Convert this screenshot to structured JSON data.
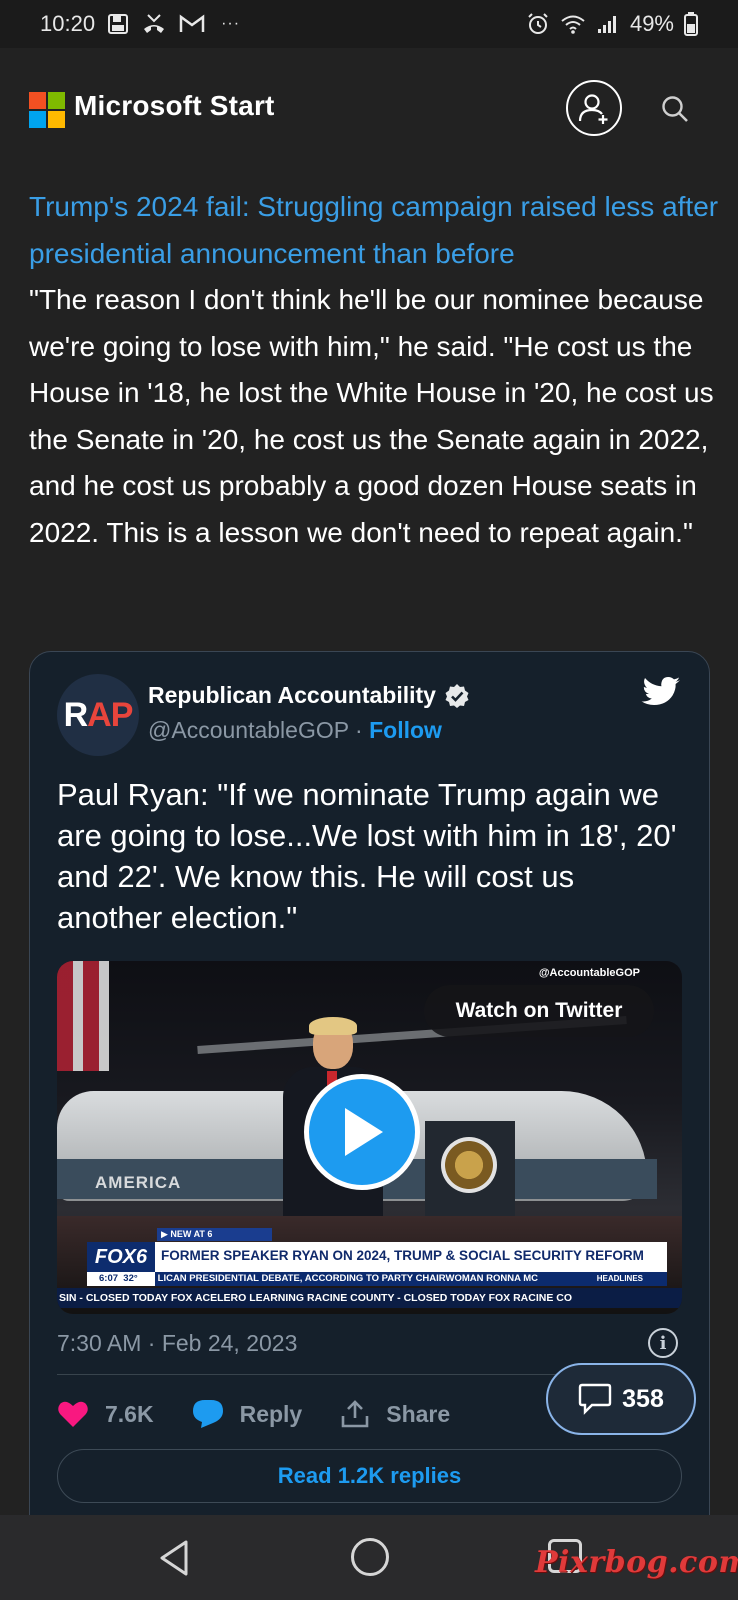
{
  "status_bar": {
    "time": "10:20",
    "battery": "49%",
    "overflow": "···"
  },
  "app": {
    "brand": "Microsoft Start",
    "logo_colors": [
      "#f25022",
      "#7fba00",
      "#00a4ef",
      "#ffb900"
    ]
  },
  "article": {
    "headline": "Trump's 2024 fail: Struggling campaign raised less after presidential announcement than before",
    "quote": "\"The reason I don't think he'll be our nominee because we're going to lose with him,\" he said. \"He cost us the House in '18, he lost the White House in '20, he cost us the Senate in '20, he cost us the Senate again in 2022, and he cost us probably a good dozen House seats in 2022. This is a lesson we don't need to repeat again.\""
  },
  "tweet": {
    "avatar_r": "R",
    "avatar_ap": "AP",
    "account_name": "Republican Accountability",
    "handle": "@AccountableGOP",
    "separator": " · ",
    "follow_label": "Follow",
    "text": "Paul Ryan: \"If we nominate Trump again we are going to lose...We lost with him in 18', 20' and 22'. We know this. He will cost us another election.\"",
    "timestamp": "7:30 AM · Feb 24, 2023",
    "likes": "7.6K",
    "reply_label": "Reply",
    "share_label": "Share",
    "read_replies_label": "Read 1.2K replies",
    "video": {
      "watermark": "@AccountableGOP",
      "watch_label": "Watch on Twitter",
      "heli_text": "AMERICA",
      "news_tag": "▶ NEW AT 6",
      "station": "FOX6",
      "headline": "FORMER SPEAKER RYAN ON 2024, TRUMP & SOCIAL SECURITY REFORM",
      "time": "6:07",
      "temp": "32°",
      "sub": "LICAN PRESIDENTIAL DEBATE, ACCORDING TO PARTY CHAIRWOMAN RONNA MC",
      "sub_tag": "HEADLINES",
      "ticker": "SIN - CLOSED TODAY    FOX    ACELERO LEARNING RACINE COUNTY - CLOSED TODAY    FOX    RACINE CO"
    }
  },
  "comments": {
    "count": "358"
  },
  "watermark": "Pixrbog.com",
  "colors": {
    "background": "#222222",
    "link": "#3a9ee6",
    "tweet_bg": "#15202b",
    "twitter_blue": "#1d9bf0",
    "like_pink": "#f91880"
  }
}
